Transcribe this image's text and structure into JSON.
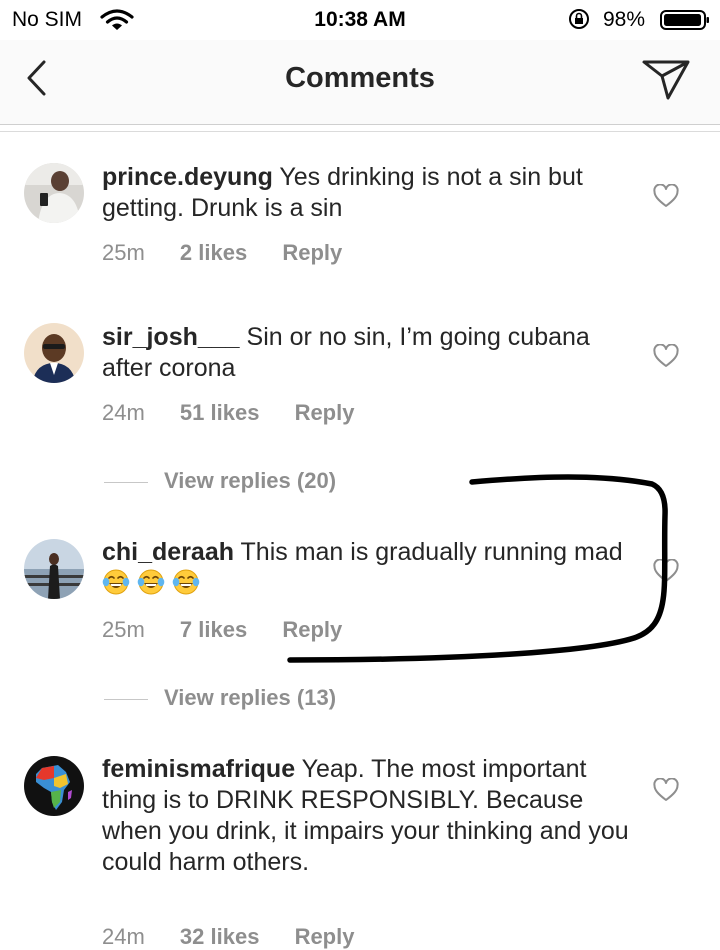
{
  "status_bar": {
    "carrier": "No SIM",
    "time": "10:38 AM",
    "battery": "98%"
  },
  "header": {
    "title": "Comments"
  },
  "comments": [
    {
      "username": "prince.deyung",
      "text": "Yes drinking is not a sin but getting. Drunk is a sin",
      "time": "25m",
      "likes": "2 likes",
      "reply_label": "Reply"
    },
    {
      "username": "sir_josh___",
      "text": "Sin or no sin, I’m going cubana after corona",
      "time": "24m",
      "likes": "51 likes",
      "reply_label": "Reply",
      "view_replies": "View replies (20)"
    },
    {
      "username": "chi_deraah",
      "text": "This man is gradually running mad",
      "emoji": [
        "face-with-tears-of-joy",
        "face-with-tears-of-joy",
        "face-with-tears-of-joy"
      ],
      "time": "25m",
      "likes": "7 likes",
      "reply_label": "Reply",
      "view_replies": "View replies (13)"
    },
    {
      "username": "feminismafrique",
      "text": "Yeap. The most important thing is to DRINK RESPONSIBLY. Because when you drink, it impairs your thinking and you could harm others.",
      "time": "24m",
      "likes": "32 likes",
      "reply_label": "Reply"
    }
  ],
  "icons": {
    "back": "chevron-left-icon",
    "send": "paper-plane-icon",
    "like": "heart-outline-icon"
  },
  "colors": {
    "text": "#262626",
    "meta": "#8e8e8e",
    "header_bg": "#fafafa",
    "annotation": "#000000"
  }
}
